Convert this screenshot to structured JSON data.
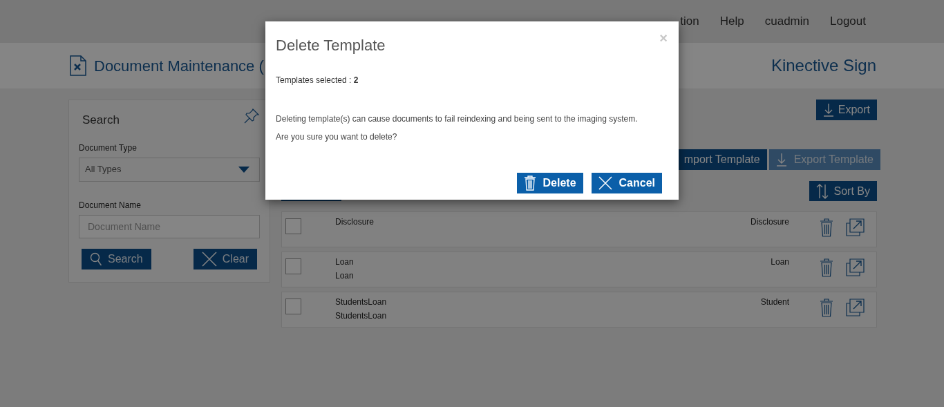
{
  "nav": [
    {
      "label": "tion"
    },
    {
      "label": "Help"
    },
    {
      "label": "cuadmin"
    },
    {
      "label": "Logout"
    }
  ],
  "page_title": "Document Maintenance (",
  "brand": "Kinective Sign",
  "search_panel": {
    "title": "Search",
    "document_type": {
      "label": "Document Type",
      "value": "All Types"
    },
    "document_name": {
      "label": "Document Name",
      "placeholder": "Document Name"
    },
    "buttons": [
      {
        "label": "Search",
        "kind": "search"
      },
      {
        "label": "Clear",
        "kind": "clear"
      }
    ]
  },
  "export_button": "Export",
  "template_buttons": [
    {
      "label": "mport Template",
      "disabled": false
    },
    {
      "label": "Export Template",
      "disabled": true
    }
  ],
  "sort_button": "Sort By",
  "templates": [
    {
      "checked": false,
      "lines": [
        "Disclosure"
      ],
      "type": "Disclosure"
    },
    {
      "checked": false,
      "lines": [
        "Loan",
        "Loan"
      ],
      "type": "Loan"
    },
    {
      "checked": false,
      "lines": [
        "StudentsLoan",
        "StudentsLoan"
      ],
      "type": "Student"
    }
  ],
  "dialog": {
    "title": "Delete Template",
    "close": "×",
    "selected": "Templates selected : **2**",
    "message": [
      "Deleting template(s) can cause documents to fail reindexing and being sent to the imaging system.",
      "Are you sure you want to delete?"
    ],
    "buttons": [
      {
        "label": "Delete",
        "kind": "delete"
      },
      {
        "label": "Cancel",
        "kind": "cancel"
      }
    ]
  }
}
